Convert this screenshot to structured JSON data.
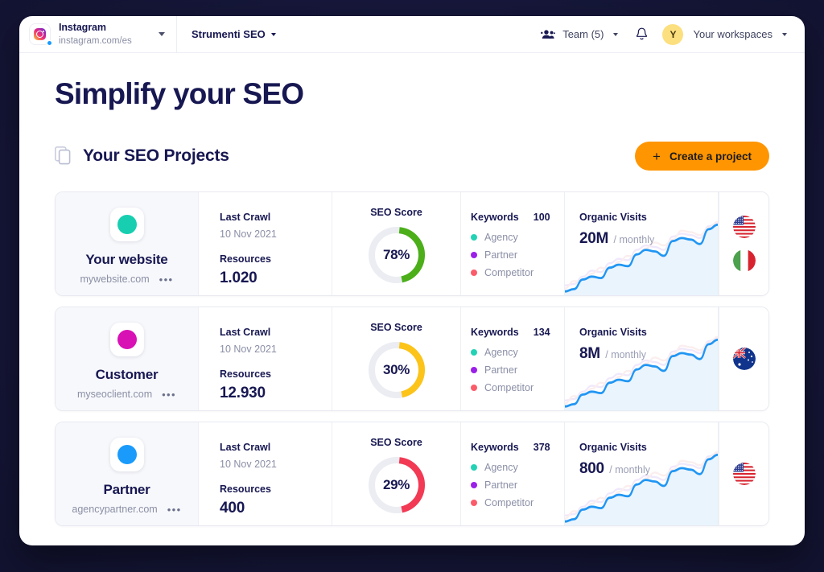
{
  "topbar": {
    "site_name": "Instagram",
    "site_url": "instagram.com/es",
    "tool_menu": "Strumenti SEO",
    "team_label": "Team (5)",
    "avatar_initial": "Y",
    "workspaces_label": "Your workspaces",
    "icons": {
      "site_dropdown": "chevron-down-icon",
      "tool_dropdown": "chevron-down-icon",
      "team": "team-icon",
      "bell": "bell-icon",
      "workspaces_dropdown": "chevron-down-icon"
    }
  },
  "page": {
    "title": "Simplify your SEO",
    "section_title": "Your SEO Projects",
    "section_icon": "documents-icon",
    "create_button": {
      "label": "Create a project",
      "icon": "plus-icon",
      "color": "#ff9500"
    }
  },
  "labels": {
    "last_crawl": "Last Crawl",
    "resources": "Resources",
    "seo_score": "SEO Score",
    "keywords": "Keywords",
    "organic_visits": "Organic Visits",
    "monthly_suffix": "/ monthly",
    "overflow_menu": "•••"
  },
  "keyword_legend": [
    {
      "label": "Agency",
      "color": "#23d2b5"
    },
    {
      "label": "Partner",
      "color": "#9b20e8"
    },
    {
      "label": "Competitor",
      "color": "#fb5c6a"
    }
  ],
  "projects": [
    {
      "name": "Your website",
      "url": "mywebsite.com",
      "avatar_color": "#17cfb0",
      "last_crawl": "10 Nov 2021",
      "resources": "1.020",
      "seo_score": "78%",
      "seo_score_value": 78,
      "seo_score_color": "#4caf1a",
      "keywords_count": "100",
      "organic_visits": "20M",
      "flags": [
        "flag-us",
        "flag-it"
      ]
    },
    {
      "name": "Customer",
      "url": "myseoclient.com",
      "avatar_color": "#d811b5",
      "last_crawl": "10 Nov 2021",
      "resources": "12.930",
      "seo_score": "30%",
      "seo_score_value": 30,
      "seo_score_color": "#fcc419",
      "keywords_count": "134",
      "organic_visits": "8M",
      "flags": [
        "flag-au"
      ]
    },
    {
      "name": "Partner",
      "url": "agencypartner.com",
      "avatar_color": "#1a9bfc",
      "last_crawl": "10 Nov 2021",
      "resources": "400",
      "seo_score": "29%",
      "seo_score_value": 29,
      "seo_score_color": "#f23a54",
      "keywords_count": "378",
      "organic_visits": "800",
      "flags": [
        "flag-us"
      ]
    }
  ],
  "chart_data": {
    "type": "area",
    "title": "Organic Visits",
    "series": [
      {
        "name": "main",
        "color": "#2196f3",
        "values": [
          2,
          5,
          18,
          22,
          20,
          34,
          38,
          36,
          52,
          58,
          56,
          50,
          70,
          74,
          72,
          66,
          86,
          92
        ]
      },
      {
        "name": "ghost-purple",
        "color": "#f0e8fb",
        "values": [
          10,
          12,
          22,
          30,
          28,
          40,
          46,
          44,
          58,
          64,
          62,
          58,
          76,
          80,
          78,
          74,
          90,
          94
        ]
      },
      {
        "name": "ghost-pink",
        "color": "#fbeeee",
        "values": [
          6,
          16,
          14,
          26,
          34,
          30,
          42,
          50,
          48,
          60,
          68,
          64,
          72,
          84,
          82,
          78,
          88,
          96
        ]
      }
    ],
    "grid": false,
    "legend": "none",
    "ylabel": "",
    "xlabel": ""
  }
}
